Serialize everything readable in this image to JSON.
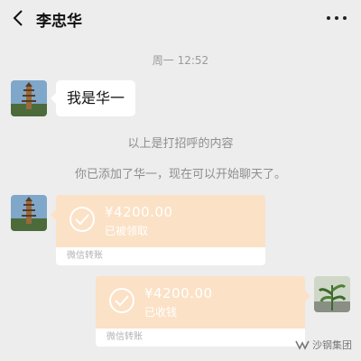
{
  "header": {
    "title": "李忠华",
    "back_icon": "chevron-left-icon",
    "more_icon": "more-horizontal-icon"
  },
  "chat": {
    "timestamp": "周一 12:52",
    "messages": [
      {
        "type": "text",
        "side": "left",
        "text": "我是华一"
      },
      {
        "type": "system",
        "text": "以上是打招呼的内容"
      },
      {
        "type": "system",
        "text": "你已添加了华一，现在可以开始聊天了。"
      },
      {
        "type": "transfer",
        "side": "left",
        "amount": "¥4200.00",
        "status": "已被领取",
        "footer": "微信转账"
      },
      {
        "type": "transfer",
        "side": "right",
        "amount": "¥4200.00",
        "status": "已收钱",
        "footer": "微信转账"
      }
    ]
  },
  "watermark": {
    "text": "沙钢集团",
    "icon": "wechat-channel-icon"
  },
  "colors": {
    "background": "#ededed",
    "transfer_bubble": "#fbe1c6",
    "text_bubble": "#ffffff"
  }
}
